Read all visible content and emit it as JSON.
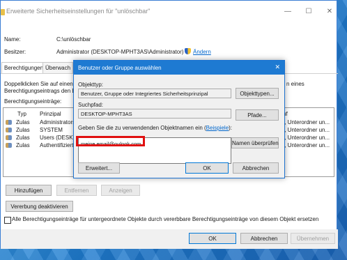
{
  "window": {
    "title": "Erweiterte Sicherheitseinstellungen für \"unlöschbar\"",
    "minimize": "—",
    "maximize": "☐",
    "close": "✕"
  },
  "info": {
    "name_label": "Name:",
    "name_value": "C:\\unlöschbar",
    "owner_label": "Besitzer:",
    "owner_value": "Administrator (DESKTOP-MPHT3AS\\Administrator)",
    "change_link": "Ändern"
  },
  "tabs": [
    "Berechtigungen",
    "Überwach"
  ],
  "description": {
    "line1": "Doppelklicken Sie auf einen E",
    "line2": "Berechtigungseintrags den Ei",
    "line1_suffix": "n eines",
    "entries_label": "Berechtigungseinträge:"
  },
  "list": {
    "col_type": "Typ",
    "col_principal": "Prinzipal",
    "col_applies_suffix": "uf",
    "rows": [
      {
        "type": "Zulas",
        "principal": "Administrators",
        "applies": "r, Unterordner un..."
      },
      {
        "type": "Zulas",
        "principal": "SYSTEM",
        "applies": "r, Unterordner un..."
      },
      {
        "type": "Zulas",
        "principal": "Users (DESKTO",
        "applies": "r, Unterordner un..."
      },
      {
        "type": "Zulas",
        "principal": "Authentifiziert",
        "applies": "r, Unterordner un..."
      }
    ]
  },
  "buttons": {
    "add": "Hinzufügen",
    "remove": "Entfernen",
    "view": "Anzeigen",
    "disable_inheritance": "Vererbung deaktivieren",
    "ok": "OK",
    "cancel": "Abbrechen",
    "apply": "Übernehmen"
  },
  "replace_checkbox_label": "Alle Berechtigungseinträge für untergeordnete Objekte durch vererbbare Berechtigungseinträge von diesem Objekt ersetzen",
  "dialog": {
    "title": "Benutzer oder Gruppe auswählen",
    "close": "✕",
    "object_type_label": "Objekttyp:",
    "object_type_value": "Benutzer, Gruppe oder Integriertes Sicherheitsprinzipal",
    "object_types_button": "Objekttypen...",
    "location_label": "Suchpfad:",
    "location_value": "DESKTOP-MPHT3AS",
    "paths_button": "Pfade...",
    "enter_label": "Geben Sie die zu verwendenden Objektnamen ein (",
    "enter_link": "Beispiele",
    "enter_label_end": "):",
    "input_value": "meine email@oulook.com",
    "check_names_button": "Namen überprüfen",
    "advanced_button": "Erweitert...",
    "ok_button": "OK",
    "cancel_button": "Abbrechen"
  },
  "colors": {
    "accent": "#1e7ad2",
    "highlight": "#e01010",
    "link": "#0066cc"
  }
}
